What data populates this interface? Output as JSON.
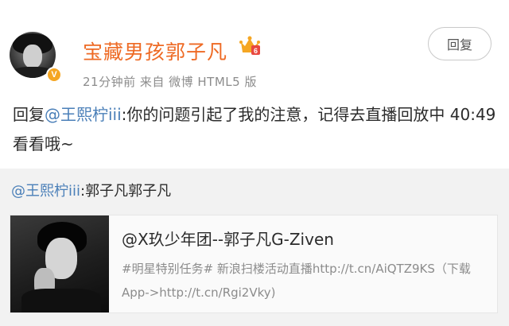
{
  "post": {
    "username": "宝藏男孩郭子凡",
    "badge_icon": "crown-icon",
    "verified_icon": "verified-v-icon",
    "verified_letter": "V",
    "meta": "21分钟前  来自 微博 HTML5 版",
    "reply_button": "回复",
    "content": {
      "prefix": "回复",
      "mention": "@王熙柠iii",
      "text": ":你的问题引起了我的注意，记得去直播回放中 40:49 看看哦~"
    }
  },
  "repost": {
    "mention": "@王熙柠iii",
    "text": ":郭子凡郭子凡",
    "card": {
      "title": "@X玖少年团--郭子凡G-Ziven",
      "description": "#明星特别任务# 新浪扫楼活动直播http://t.cn/AiQTZ9KS（下载App->http://t.cn/Rgi2Vky)"
    }
  },
  "colors": {
    "username": "#ee6a24",
    "mention": "#4a7fb8",
    "meta": "#8c8c8c",
    "badge": "#f5a623"
  }
}
